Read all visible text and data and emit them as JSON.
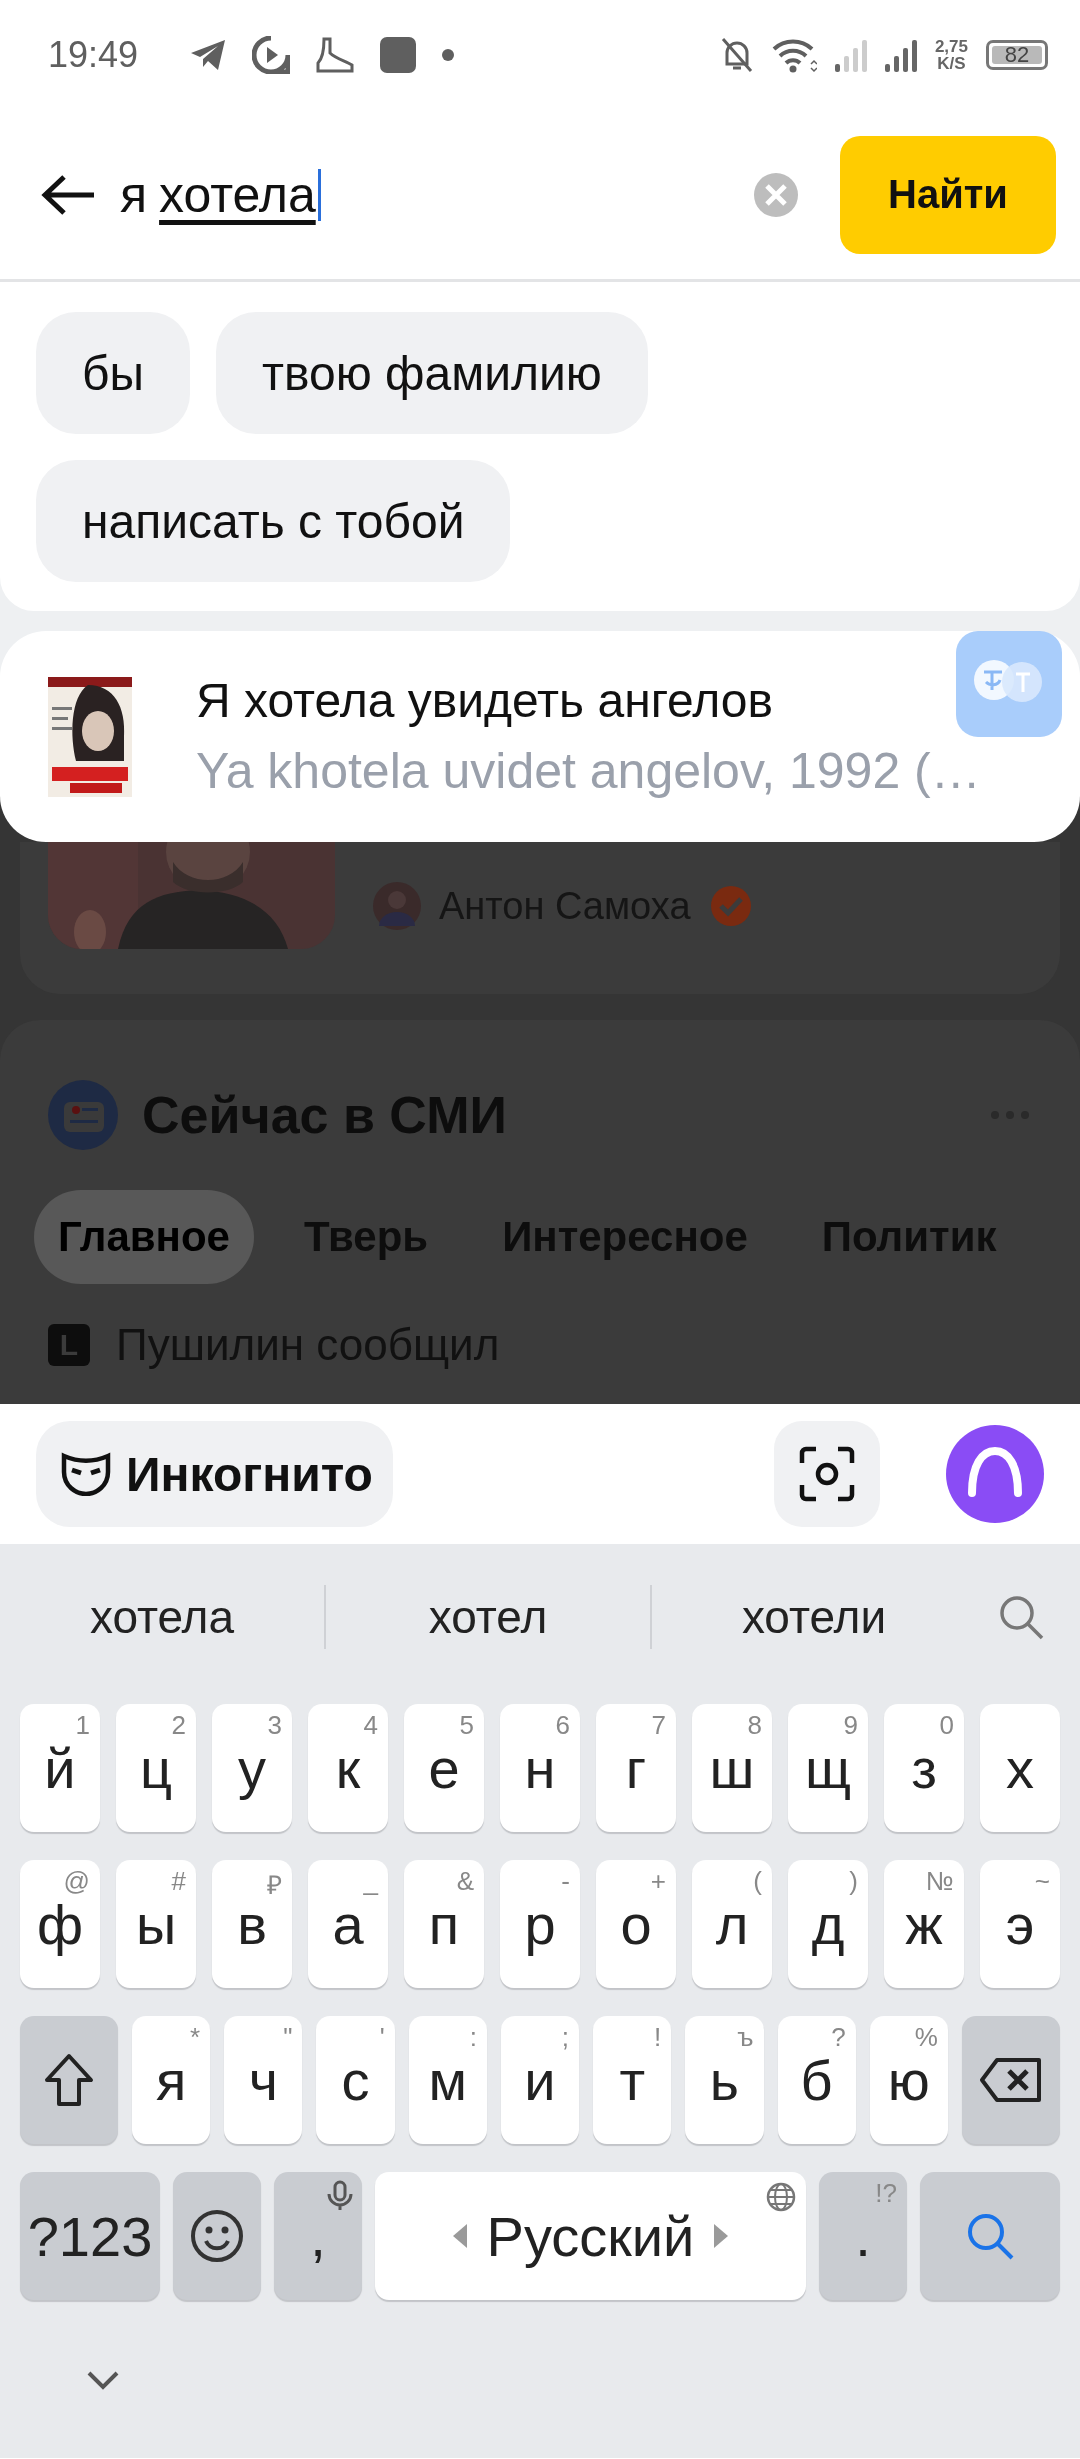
{
  "status_bar": {
    "time": "19:49",
    "speed_value": "2,75",
    "speed_unit": "K/S",
    "battery": "82"
  },
  "search": {
    "typed": "я",
    "composing": "хотела",
    "button": "Найти"
  },
  "chips": [
    "бы",
    "твою фамилию",
    "написать с тобой"
  ],
  "suggestion": {
    "title": "Я хотела увидеть ангелов",
    "subtitle": "Ya khotela uvidet angelov, 1992 (…"
  },
  "background": {
    "author": "Антон Самоха",
    "verified": true,
    "section_title": "Сейчас в СМИ",
    "tabs": [
      {
        "label": "Главное",
        "selected": true
      },
      {
        "label": "Тверь",
        "selected": false
      },
      {
        "label": "Интересное",
        "selected": false
      },
      {
        "label": "Политик",
        "selected": false
      }
    ],
    "news": [
      {
        "source": "L",
        "text": "Пушилин сообщил"
      }
    ]
  },
  "bottom_bar": {
    "incognito": "Инкогнито"
  },
  "keyboard": {
    "suggestions": [
      "хотела",
      "хотел",
      "хотели"
    ],
    "letter_rows": [
      [
        {
          "kind": "letter",
          "label": "й",
          "hint": "1"
        },
        {
          "kind": "letter",
          "label": "ц",
          "hint": "2"
        },
        {
          "kind": "letter",
          "label": "у",
          "hint": "3"
        },
        {
          "kind": "letter",
          "label": "к",
          "hint": "4"
        },
        {
          "kind": "letter",
          "label": "е",
          "hint": "5"
        },
        {
          "kind": "letter",
          "label": "н",
          "hint": "6"
        },
        {
          "kind": "letter",
          "label": "г",
          "hint": "7"
        },
        {
          "kind": "letter",
          "label": "ш",
          "hint": "8"
        },
        {
          "kind": "letter",
          "label": "щ",
          "hint": "9"
        },
        {
          "kind": "letter",
          "label": "з",
          "hint": "0"
        },
        {
          "kind": "letter",
          "label": "х"
        }
      ],
      [
        {
          "kind": "letter",
          "label": "ф",
          "hint": "@"
        },
        {
          "kind": "letter",
          "label": "ы",
          "hint": "#"
        },
        {
          "kind": "letter",
          "label": "в",
          "hint": "₽"
        },
        {
          "kind": "letter",
          "label": "а",
          "hint": "_"
        },
        {
          "kind": "letter",
          "label": "п",
          "hint": "&"
        },
        {
          "kind": "letter",
          "label": "р",
          "hint": "-"
        },
        {
          "kind": "letter",
          "label": "о",
          "hint": "+"
        },
        {
          "kind": "letter",
          "label": "л",
          "hint": "("
        },
        {
          "kind": "letter",
          "label": "д",
          "hint": ")"
        },
        {
          "kind": "letter",
          "label": "ж",
          "hint": "№"
        },
        {
          "kind": "letter",
          "label": "э",
          "hint": "~"
        }
      ],
      [
        {
          "kind": "shift"
        },
        {
          "kind": "letter",
          "label": "я",
          "hint": "*"
        },
        {
          "kind": "letter",
          "label": "ч",
          "hint": "\""
        },
        {
          "kind": "letter",
          "label": "с",
          "hint": "'"
        },
        {
          "kind": "letter",
          "label": "м",
          "hint": ":"
        },
        {
          "kind": "letter",
          "label": "и",
          "hint": ";"
        },
        {
          "kind": "letter",
          "label": "т",
          "hint": "!"
        },
        {
          "kind": "letter",
          "label": "ь",
          "hint": "ъ"
        },
        {
          "kind": "letter",
          "label": "б",
          "hint": "?"
        },
        {
          "kind": "letter",
          "label": "ю",
          "hint": "%"
        },
        {
          "kind": "backspace"
        }
      ]
    ],
    "bottom_row": [
      {
        "kind": "symbols",
        "label": "?123"
      },
      {
        "kind": "emoji"
      },
      {
        "kind": "comma",
        "label": ","
      },
      {
        "kind": "space",
        "label": "Русский"
      },
      {
        "kind": "period",
        "label": ".",
        "hint": "!?"
      },
      {
        "kind": "search"
      }
    ]
  }
}
